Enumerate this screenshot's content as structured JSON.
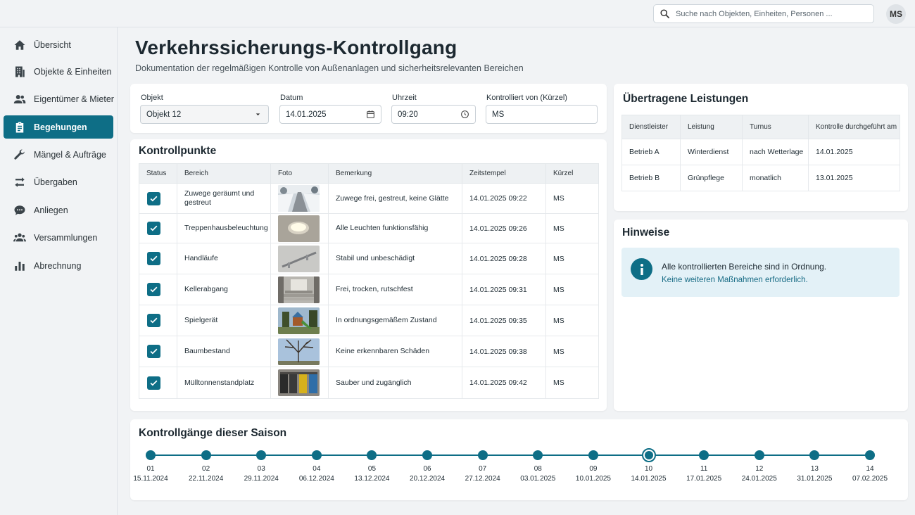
{
  "search": {
    "placeholder": "Suche nach Objekten, Einheiten, Personen ..."
  },
  "user": {
    "initials": "MS"
  },
  "sidebar": {
    "items": [
      {
        "label": "Übersicht",
        "icon": "home-icon"
      },
      {
        "label": "Objekte & Einheiten",
        "icon": "building-icon"
      },
      {
        "label": "Eigentümer & Mieter",
        "icon": "people-icon"
      },
      {
        "label": "Begehungen",
        "icon": "clipboard-icon",
        "active": true
      },
      {
        "label": "Mängel & Aufträge",
        "icon": "wrench-icon"
      },
      {
        "label": "Übergaben",
        "icon": "swap-arrows-icon"
      },
      {
        "label": "Anliegen",
        "icon": "chat-bubble-icon"
      },
      {
        "label": "Versammlungen",
        "icon": "group-icon"
      },
      {
        "label": "Abrechnung",
        "icon": "bar-chart-icon"
      }
    ]
  },
  "header": {
    "title": "Verkehrssicherungs-Kontrollgang",
    "subtitle": "Dokumentation der regelmäßigen Kontrolle von Außenanlagen und sicherheitsrelevanten Bereichen"
  },
  "form": {
    "object_label": "Objekt",
    "object_value": "Objekt 12",
    "date_label": "Datum",
    "date_value": "14.01.2025",
    "time_label": "Uhrzeit",
    "time_value": "09:20",
    "inspector_label": "Kontrolliert von (Kürzel)",
    "inspector_value": "MS"
  },
  "checkpoints": {
    "title": "Kontrollpunkte",
    "columns": [
      "Status",
      "Bereich",
      "Foto",
      "Bemerkung",
      "Zeitstempel",
      "Kürzel"
    ],
    "rows": [
      {
        "checked": true,
        "area": "Zuwege geräumt und gestreut",
        "photo": "snowy-path-photo",
        "note": "Zuwege frei, gestreut, keine Glätte",
        "timestamp": "14.01.2025 09:22",
        "initials": "MS"
      },
      {
        "checked": true,
        "area": "Treppenhausbeleuchtung",
        "photo": "ceiling-light-photo",
        "note": "Alle Leuchten funktionsfähig",
        "timestamp": "14.01.2025 09:26",
        "initials": "MS"
      },
      {
        "checked": true,
        "area": "Handläufe",
        "photo": "handrail-photo",
        "note": "Stabil und unbeschädigt",
        "timestamp": "14.01.2025 09:28",
        "initials": "MS"
      },
      {
        "checked": true,
        "area": "Kellerabgang",
        "photo": "basement-stairs-photo",
        "note": "Frei, trocken, rutschfest",
        "timestamp": "14.01.2025 09:31",
        "initials": "MS"
      },
      {
        "checked": true,
        "area": "Spielgerät",
        "photo": "playground-photo",
        "note": "In ordnungsgemäßem Zustand",
        "timestamp": "14.01.2025 09:35",
        "initials": "MS"
      },
      {
        "checked": true,
        "area": "Baumbestand",
        "photo": "tree-photo",
        "note": "Keine erkennbaren Schäden",
        "timestamp": "14.01.2025 09:38",
        "initials": "MS"
      },
      {
        "checked": true,
        "area": "Mülltonnenstandplatz",
        "photo": "bins-photo",
        "note": "Sauber und zugänglich",
        "timestamp": "14.01.2025 09:42",
        "initials": "MS"
      }
    ]
  },
  "services": {
    "title": "Übertragene Leistungen",
    "columns": [
      "Dienstleister",
      "Leistung",
      "Turnus",
      "Kontrolle durchgeführt am"
    ],
    "rows": [
      {
        "provider": "Betrieb A",
        "service": "Winterdienst",
        "interval": "nach Wetterlage",
        "checked_on": "14.01.2025"
      },
      {
        "provider": "Betrieb B",
        "service": "Grünpflege",
        "interval": "monatlich",
        "checked_on": "13.01.2025"
      }
    ]
  },
  "notes": {
    "title": "Hinweise",
    "line1": "Alle kontrollierten Bereiche sind in Ordnung.",
    "line2": "Keine weiteren Maßnahmen erforderlich."
  },
  "timeline": {
    "title": "Kontrollgänge dieser Saison",
    "current_index": 9,
    "items": [
      {
        "num": "01",
        "date": "15.11.2024"
      },
      {
        "num": "02",
        "date": "22.11.2024"
      },
      {
        "num": "03",
        "date": "29.11.2024"
      },
      {
        "num": "04",
        "date": "06.12.2024"
      },
      {
        "num": "05",
        "date": "13.12.2024"
      },
      {
        "num": "06",
        "date": "20.12.2024"
      },
      {
        "num": "07",
        "date": "27.12.2024"
      },
      {
        "num": "08",
        "date": "03.01.2025"
      },
      {
        "num": "09",
        "date": "10.01.2025"
      },
      {
        "num": "10",
        "date": "14.01.2025"
      },
      {
        "num": "11",
        "date": "17.01.2025"
      },
      {
        "num": "12",
        "date": "24.01.2025"
      },
      {
        "num": "13",
        "date": "31.01.2025"
      },
      {
        "num": "14",
        "date": "07.02.2025"
      }
    ]
  },
  "colors": {
    "accent": "#0e6e86",
    "notice_bg": "#e3f1f7"
  }
}
